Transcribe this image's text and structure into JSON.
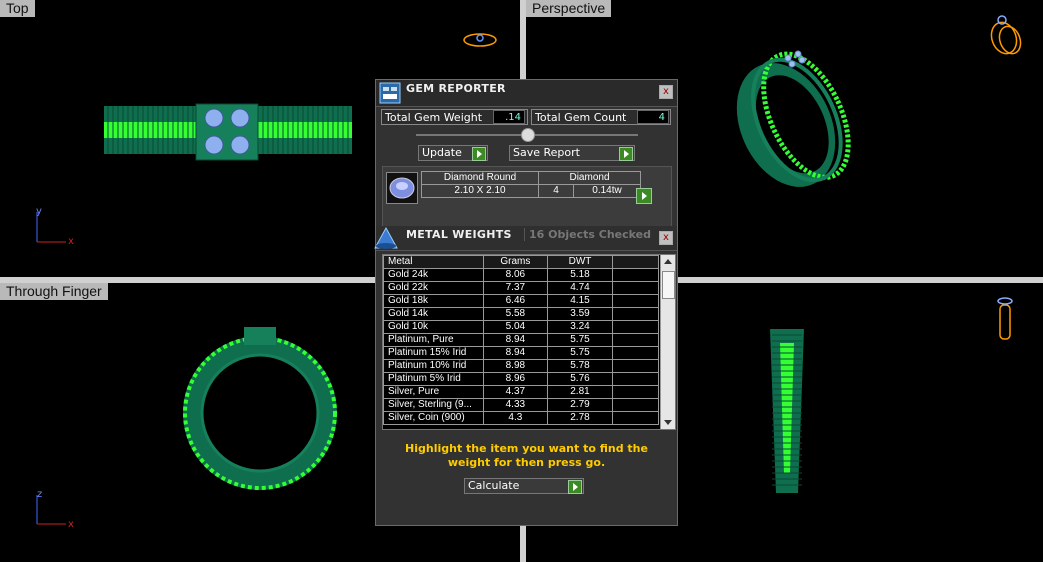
{
  "viewports": {
    "top": "Top",
    "perspective": "Perspective",
    "through_finger": "Through Finger"
  },
  "axes": {
    "x": "x",
    "y": "y",
    "z": "z"
  },
  "gem_reporter": {
    "title": "GEM REPORTER",
    "close": "x",
    "total_gem_weight_label": "Total Gem Weight",
    "total_gem_weight_value": ".14",
    "total_gem_count_label": "Total Gem Count",
    "total_gem_count_value": "4",
    "update_label": "Update",
    "save_report_label": "Save Report",
    "gem_row": {
      "shape": "Diamond Round",
      "size": "2.10 X 2.10",
      "type": "Diamond",
      "count": "4",
      "weight": "0.14tw"
    }
  },
  "metal_weights": {
    "title": "METAL WEIGHTS",
    "objects_checked": "16 Objects Checked",
    "close": "x",
    "columns": [
      "Metal",
      "Grams",
      "DWT"
    ],
    "rows": [
      [
        "Gold 24k",
        "8.06",
        "5.18"
      ],
      [
        "Gold 22k",
        "7.37",
        "4.74"
      ],
      [
        "Gold 18k",
        "6.46",
        "4.15"
      ],
      [
        "Gold 14k",
        "5.58",
        "3.59"
      ],
      [
        "Gold 10k",
        "5.04",
        "3.24"
      ],
      [
        "Platinum, Pure",
        "8.94",
        "5.75"
      ],
      [
        "Platinum 15% Irid",
        "8.94",
        "5.75"
      ],
      [
        "Platinum 10% Irid",
        "8.98",
        "5.78"
      ],
      [
        "Platinum 5% Irid",
        "8.96",
        "5.76"
      ],
      [
        "Silver, Pure",
        "4.37",
        "2.81"
      ],
      [
        "Silver, Sterling (9...",
        "4.33",
        "2.79"
      ],
      [
        "Silver, Coin (900)",
        "4.3",
        "2.78"
      ]
    ],
    "instruction": "Highlight the item you want to find the weight for then press go.",
    "calculate_label": "Calculate"
  },
  "colors": {
    "ring_dark": "#0f6e4e",
    "ring_bright": "#33ff33",
    "gem": "#7f9fe0",
    "instruction_text": "#ffcc00"
  }
}
